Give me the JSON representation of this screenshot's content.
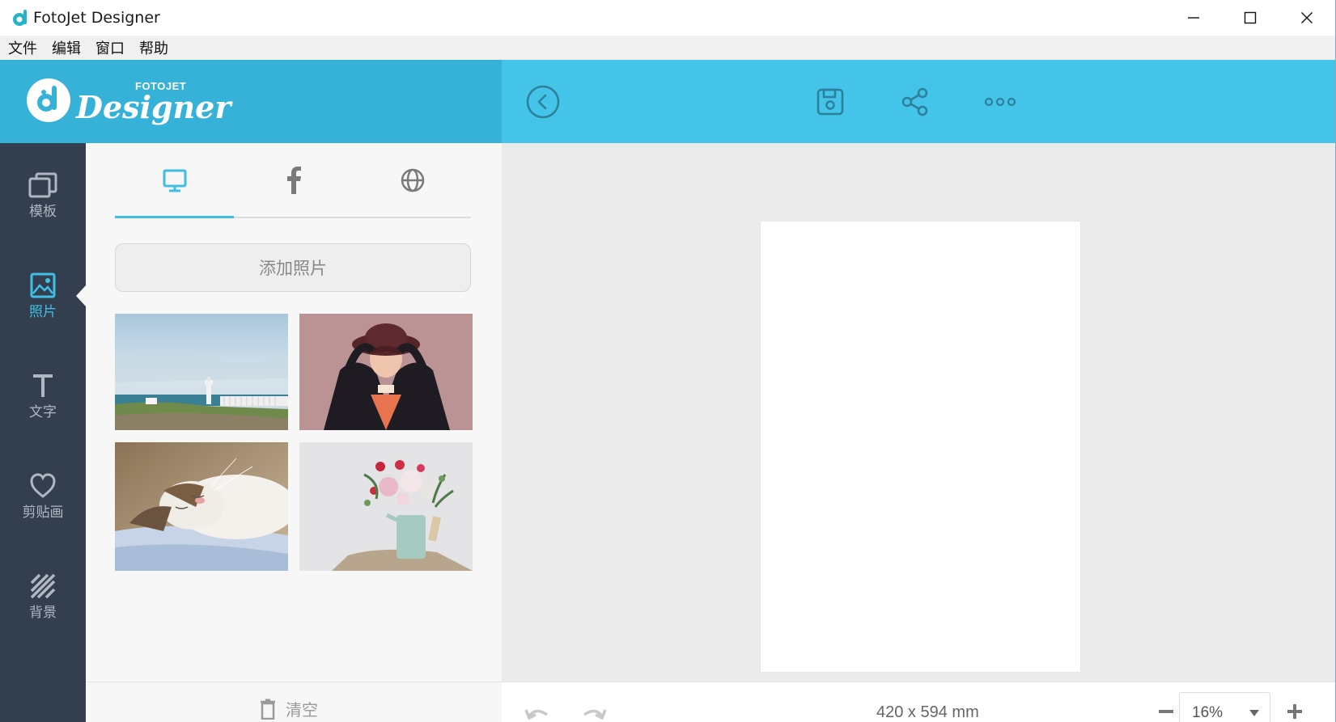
{
  "window": {
    "title": "FotoJet Designer",
    "controls": [
      "minimize",
      "maximize",
      "close"
    ]
  },
  "menubar": {
    "items": [
      "文件",
      "编辑",
      "窗口",
      "帮助"
    ]
  },
  "header": {
    "logo_brand": "FOTOJET",
    "logo_text": "Designer",
    "toolbar_icons": [
      "back-icon",
      "save-icon",
      "share-icon",
      "more-icon"
    ]
  },
  "rail": {
    "items": [
      {
        "label": "模板",
        "icon": "template-icon",
        "active": false
      },
      {
        "label": "照片",
        "icon": "photo-icon",
        "active": true
      },
      {
        "label": "文字",
        "icon": "text-icon",
        "active": false
      },
      {
        "label": "剪贴画",
        "icon": "heart-icon",
        "active": false
      },
      {
        "label": "背景",
        "icon": "pattern-icon",
        "active": false
      }
    ]
  },
  "panel": {
    "source_tabs": [
      {
        "icon": "computer-icon",
        "active": true
      },
      {
        "icon": "facebook-icon",
        "active": false
      },
      {
        "icon": "globe-icon",
        "active": false
      }
    ],
    "add_photo_label": "添加照片",
    "photos": [
      "lighthouse",
      "woman-in-hat",
      "sleeping-cat",
      "flower-vase"
    ],
    "clear_label": "清空"
  },
  "canvas": {
    "page_size": "420 x 594 mm",
    "zoom": "16%"
  },
  "colors": {
    "header_left": "#36b2d8",
    "header_right": "#44c4e8",
    "rail": "#333e4e",
    "accent": "#3fc0e6",
    "panel_bg": "#f7f7f7",
    "canvas_bg": "#ebebeb"
  }
}
